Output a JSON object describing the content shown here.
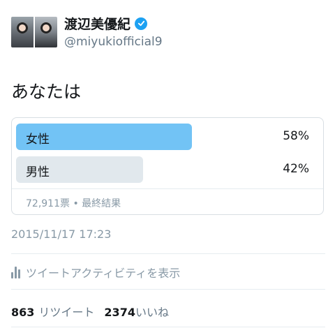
{
  "author": {
    "display_name": "渡辺美優紀",
    "handle": "@miyukiofficial9",
    "verified": true
  },
  "tweet": {
    "text": "あなたは"
  },
  "poll": {
    "options": [
      {
        "label": "女性",
        "percent_text": "58%",
        "percent": 58,
        "winner": true
      },
      {
        "label": "男性",
        "percent_text": "42%",
        "percent": 42,
        "winner": false
      }
    ],
    "votes_text": "72,911票",
    "separator": "•",
    "status_text": "最終結果"
  },
  "timestamp": "2015/11/17 17:23",
  "activity": {
    "label": "ツイートアクティビティを表示"
  },
  "stats": {
    "retweets_count": "863",
    "retweets_label": "リツイート",
    "likes_count": "2374",
    "likes_label": "いいね"
  },
  "colors": {
    "winner_bar": "#72c3f5",
    "other_bar": "#e1e8ed",
    "verified": "#1da1f2",
    "muted_text": "#8899a6"
  },
  "icons": {
    "verified": "verified-badge-icon",
    "activity": "bar-chart-icon"
  }
}
